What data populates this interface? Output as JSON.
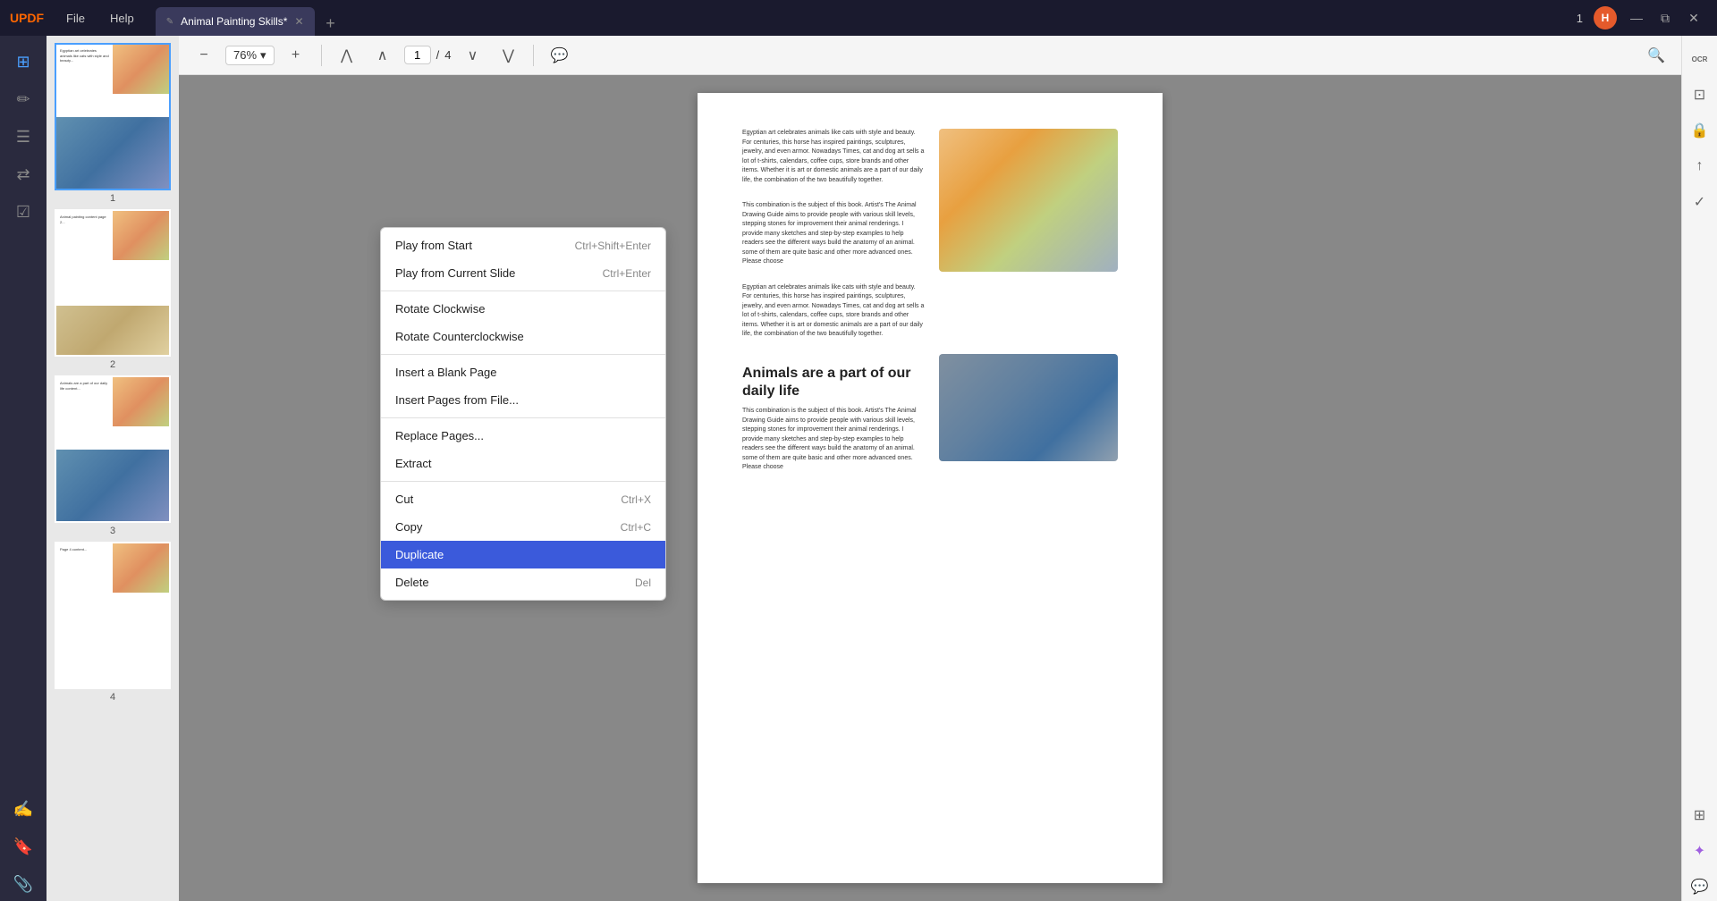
{
  "app": {
    "logo": "UPDF",
    "menu": [
      "File",
      "Help"
    ],
    "tab": {
      "label": "Animal Painting Skills*",
      "icon": "✎",
      "close": "✕"
    },
    "tab_add": "+",
    "page_indicator": "1",
    "user_avatar": "H",
    "win_controls": [
      "—",
      "⧉",
      "✕"
    ]
  },
  "toolbar": {
    "zoom_out": "−",
    "zoom_level": "76%",
    "zoom_in": "+",
    "go_first": "⋀",
    "go_prev": "∧",
    "page_current": "1",
    "page_total": "4",
    "go_next": "∨",
    "go_last": "⋁",
    "comment": "💬",
    "search": "⌕"
  },
  "sidebar_icons": [
    {
      "name": "view-icon",
      "symbol": "⊞",
      "active": true
    },
    {
      "name": "edit-icon",
      "symbol": "✏"
    },
    {
      "name": "organize-icon",
      "symbol": "☰"
    },
    {
      "name": "convert-icon",
      "symbol": "⇄"
    },
    {
      "name": "stamp-icon",
      "symbol": "☑"
    },
    {
      "name": "annotate-icon",
      "symbol": "✍"
    },
    {
      "name": "bookmark-icon",
      "symbol": "🔖"
    },
    {
      "name": "attachment-icon",
      "symbol": "📎"
    }
  ],
  "context_menu": {
    "items": [
      {
        "label": "Play from Start",
        "shortcut": "Ctrl+Shift+Enter",
        "separator_after": false
      },
      {
        "label": "Play from Current Slide",
        "shortcut": "Ctrl+Enter",
        "separator_after": true
      },
      {
        "label": "Rotate Clockwise",
        "shortcut": "",
        "separator_after": false
      },
      {
        "label": "Rotate Counterclockwise",
        "shortcut": "",
        "separator_after": true
      },
      {
        "label": "Insert a Blank Page",
        "shortcut": "",
        "separator_after": false
      },
      {
        "label": "Insert Pages from File...",
        "shortcut": "",
        "separator_after": true
      },
      {
        "label": "Replace Pages...",
        "shortcut": "",
        "separator_after": false
      },
      {
        "label": "Extract",
        "shortcut": "",
        "separator_after": true
      },
      {
        "label": "Cut",
        "shortcut": "Ctrl+X",
        "separator_after": false
      },
      {
        "label": "Copy",
        "shortcut": "Ctrl+C",
        "separator_after": false
      },
      {
        "label": "Duplicate",
        "shortcut": "",
        "separator_after": false,
        "highlighted": true
      },
      {
        "label": "Delete",
        "shortcut": "Del",
        "separator_after": false
      }
    ]
  },
  "thumbnails": [
    {
      "num": "1",
      "selected": true
    },
    {
      "num": "2",
      "selected": false
    },
    {
      "num": "3",
      "selected": false
    },
    {
      "num": "4",
      "selected": false
    }
  ],
  "pdf": {
    "heading": "Animals are a part of our daily life",
    "body_text": "Egyptian art celebrates animals like cats with style and beauty. For centuries, this horse has inspired paintings, sculptures, jewelry, and even armor. Nowadays Times, cat and dog art sells a lot of t-shirts, calendars, coffee cups, store brands and other items. Whether it is art or domestic animals are a part of our daily life, the combination of the two beautifully together.",
    "body_text2": "This combination is the subject of this book. Artist's The Animal Drawing Guide aims to provide people with various skill levels, stepping stones for improvement their animal renderings. I provide many sketches and step-by-step examples to help readers see the different ways build the anatomy of an animal. some of them are quite basic and other more advanced ones. Please choose"
  },
  "right_sidebar_icons": [
    {
      "name": "ocr-icon",
      "symbol": "OCR"
    },
    {
      "name": "compress-icon",
      "symbol": "⊡"
    },
    {
      "name": "protect-icon",
      "symbol": "🔒"
    },
    {
      "name": "share-icon",
      "symbol": "↑"
    },
    {
      "name": "check-icon",
      "symbol": "✓"
    },
    {
      "name": "layers-icon",
      "symbol": "⊞"
    },
    {
      "name": "ai-icon",
      "symbol": "✦"
    },
    {
      "name": "chat-icon",
      "symbol": "💬"
    }
  ]
}
